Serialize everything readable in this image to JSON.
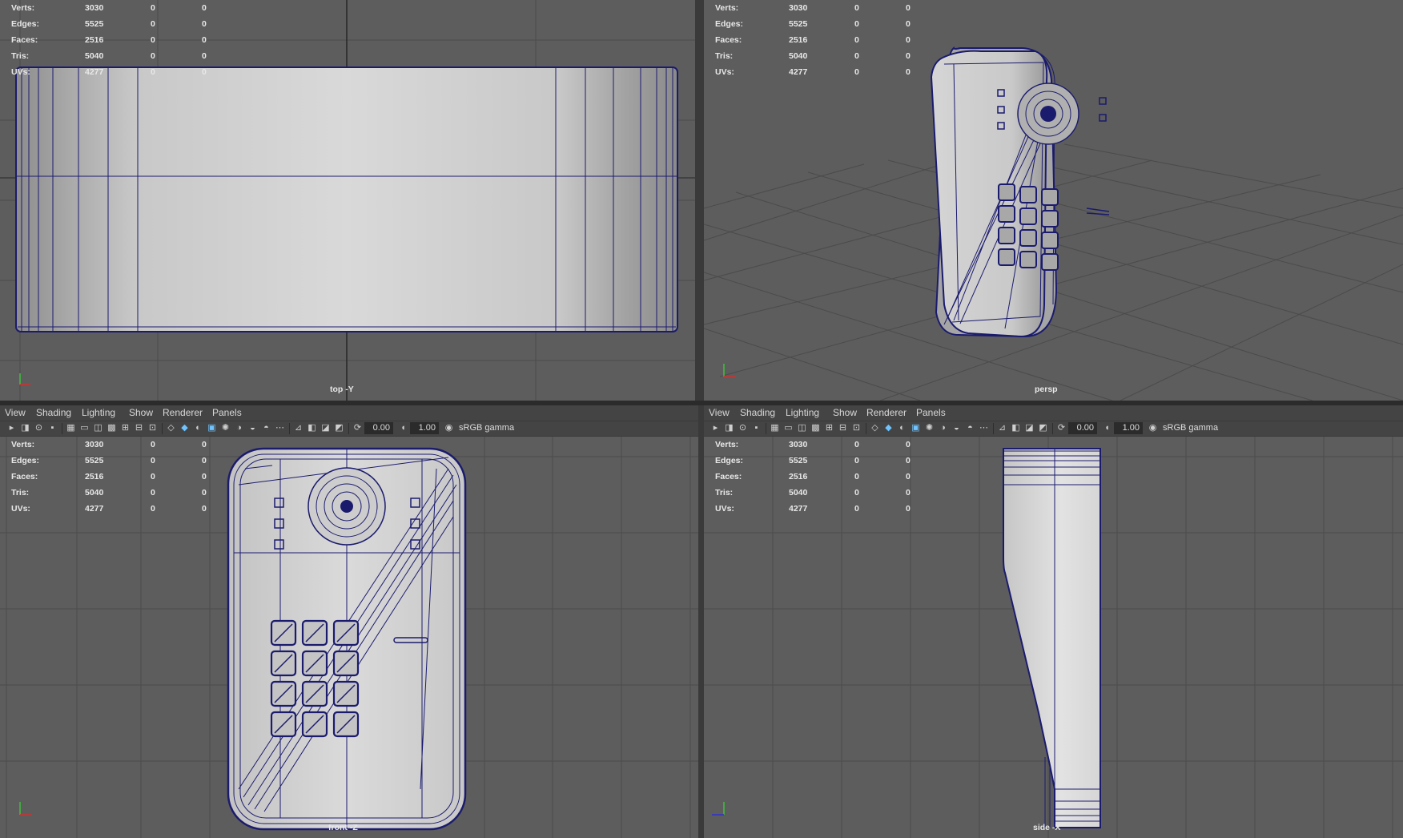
{
  "stats": {
    "labels": [
      "Verts:",
      "Edges:",
      "Faces:",
      "Tris:",
      "UVs:"
    ],
    "values": [
      [
        "3030",
        "0",
        "0"
      ],
      [
        "5525",
        "0",
        "0"
      ],
      [
        "2516",
        "0",
        "0"
      ],
      [
        "5040",
        "0",
        "0"
      ],
      [
        "4277",
        "0",
        "0"
      ]
    ]
  },
  "viewports": {
    "top": {
      "camera": "top -Y"
    },
    "persp": {
      "camera": "persp"
    },
    "front": {
      "camera": "front -Z"
    },
    "side": {
      "camera": "side -X"
    }
  },
  "menu": [
    "View",
    "Shading",
    "Lighting",
    "Show",
    "Renderer",
    "Panels"
  ],
  "toolbar": {
    "exposure": "0.00",
    "gamma": "1.00",
    "color_space": "sRGB gamma",
    "icons": [
      "camera-icon",
      "camera-attributes-icon",
      "bookmark-icon",
      "image-plane-icon",
      "grid-toggle-icon",
      "film-gate-icon",
      "resolution-gate-icon",
      "gate-mask-icon",
      "field-chart-icon",
      "safe-action-icon",
      "safe-title-icon",
      "wireframe-icon",
      "smooth-shade-icon",
      "default-material-icon",
      "textured-icon",
      "lights-icon",
      "shadows-icon",
      "ambient-occlusion-icon",
      "motion-blur-icon",
      "anti-aliasing-icon",
      "isolate-select-icon",
      "xray-icon",
      "xray-joints-icon",
      "backface-culling-icon",
      "exposure-icon",
      "gamma-icon",
      "color-management-icon"
    ]
  },
  "colors": {
    "viewport_bg": "#5d5d5d",
    "grid": "#4a4a4a",
    "wire": "#1b1b6e",
    "panel": "#444444",
    "text": "#e8e8e8"
  }
}
